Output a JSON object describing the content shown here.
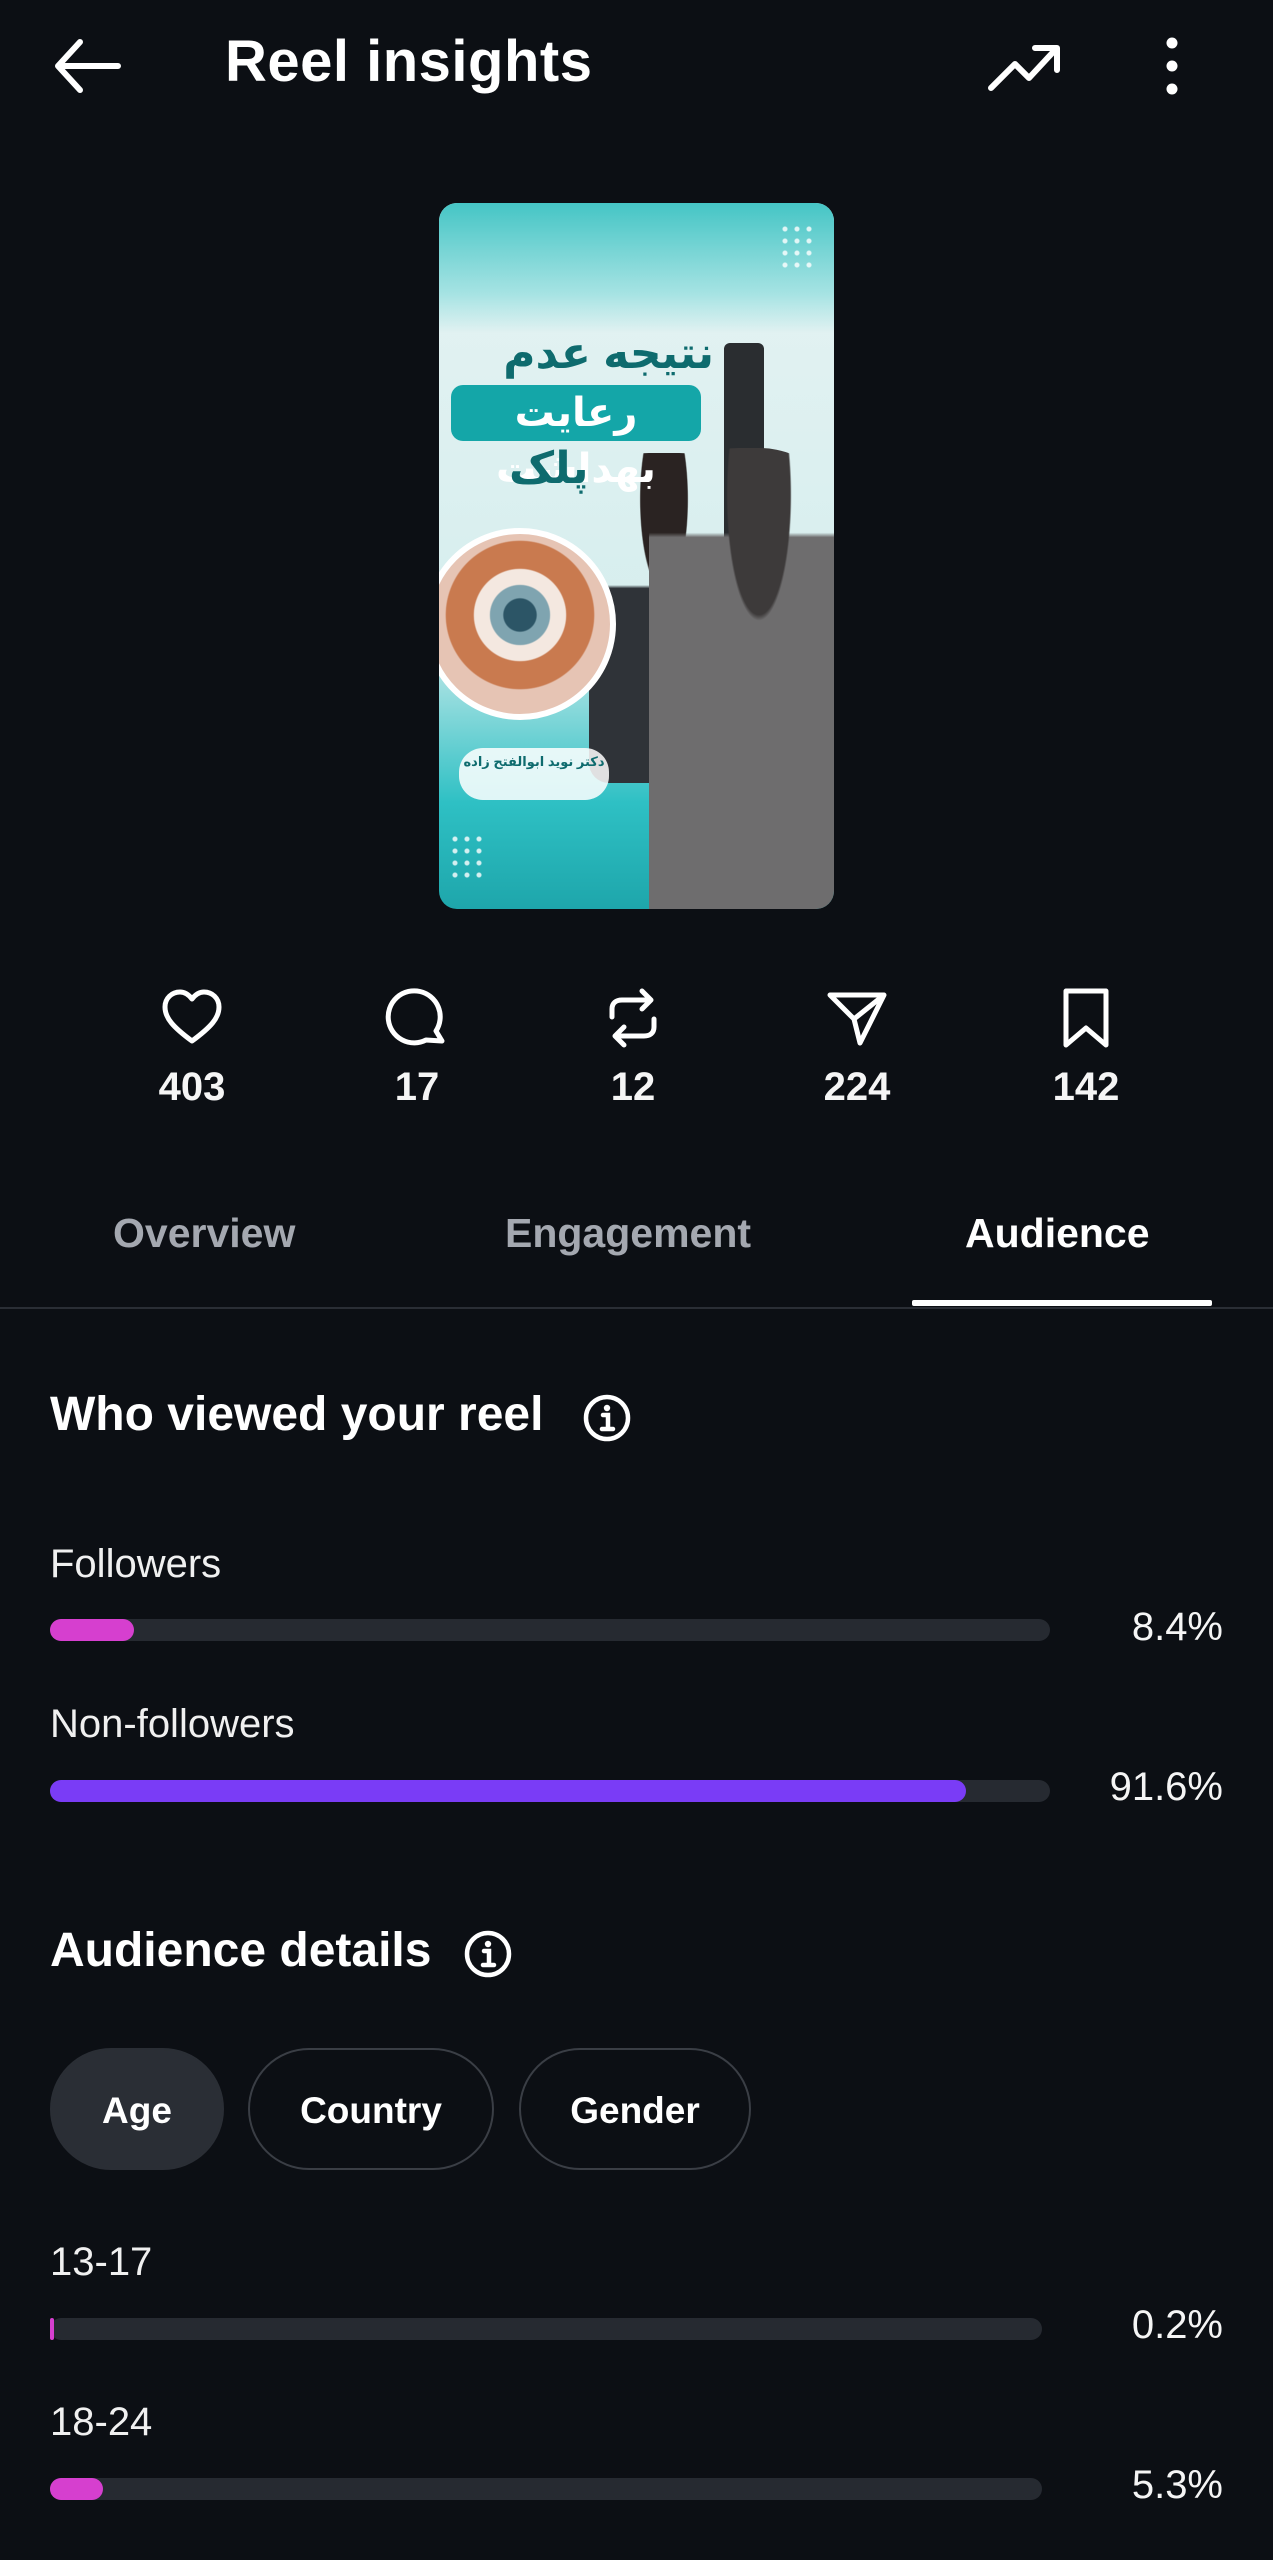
{
  "header": {
    "title": "Reel insights",
    "back_icon": "arrow-left-icon",
    "trend_icon": "trending-up-icon",
    "more_icon": "more-vertical-icon"
  },
  "thumbnail": {
    "headline_line1": "نتیجه عدم",
    "headline_line2": "رعایت بهداشت",
    "headline_line3": "پلک",
    "caption": "دکتر نوید ابوالفتح زاده"
  },
  "stats": [
    {
      "icon": "heart-icon",
      "value": "403"
    },
    {
      "icon": "comment-icon",
      "value": "17"
    },
    {
      "icon": "repost-icon",
      "value": "12"
    },
    {
      "icon": "share-icon",
      "value": "224"
    },
    {
      "icon": "bookmark-icon",
      "value": "142"
    }
  ],
  "tabs": [
    {
      "label": "Overview",
      "active": false
    },
    {
      "label": "Engagement",
      "active": false
    },
    {
      "label": "Audience",
      "active": true
    }
  ],
  "who_viewed": {
    "title": "Who viewed your reel",
    "rows": [
      {
        "label": "Followers",
        "percent_text": "8.4%",
        "fraction": 0.084,
        "color": "#d63fcf"
      },
      {
        "label": "Non-followers",
        "percent_text": "91.6%",
        "fraction": 0.916,
        "color": "#7a3cf6"
      }
    ]
  },
  "audience_details": {
    "title": "Audience details",
    "chips": [
      {
        "label": "Age",
        "active": true
      },
      {
        "label": "Country",
        "active": false
      },
      {
        "label": "Gender",
        "active": false
      }
    ],
    "rows": [
      {
        "label": "13-17",
        "percent_text": "0.2%",
        "fraction": 0.002,
        "color": "#d63fcf"
      },
      {
        "label": "18-24",
        "percent_text": "5.3%",
        "fraction": 0.053,
        "color": "#d63fcf"
      }
    ]
  }
}
